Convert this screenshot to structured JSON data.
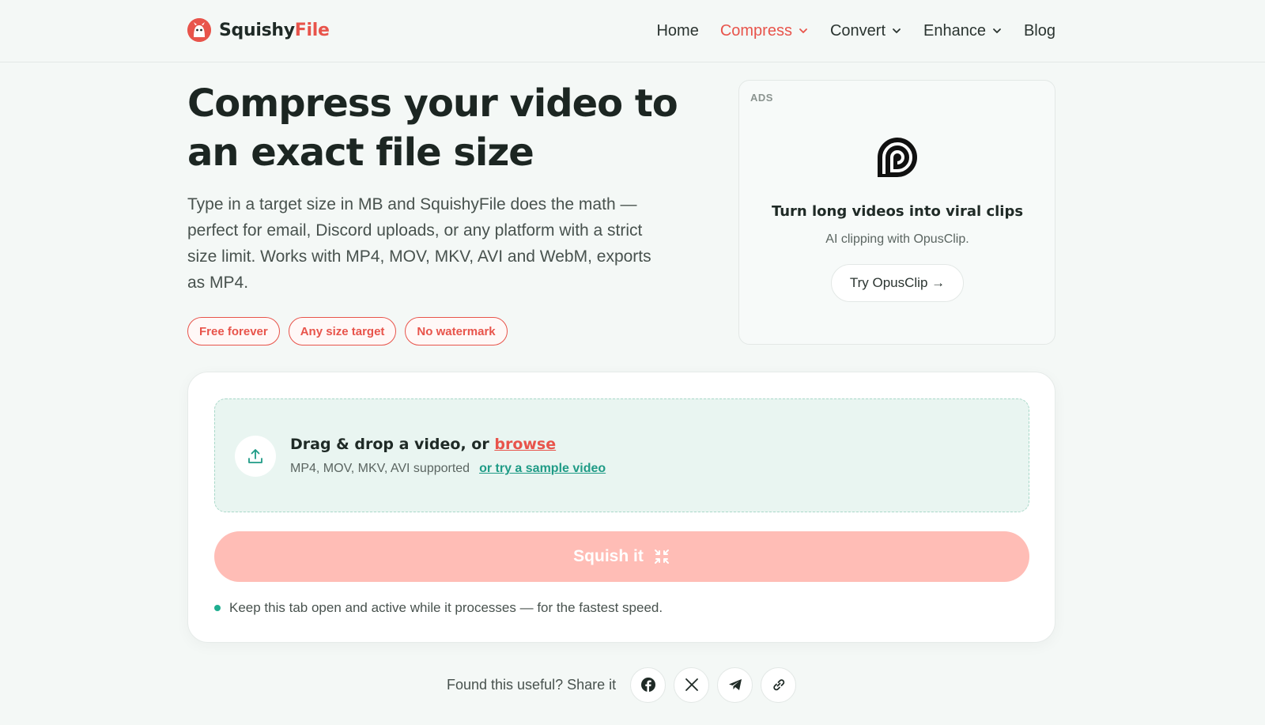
{
  "header": {
    "logo_part1": "Squishy",
    "logo_part2": "File",
    "nav": [
      {
        "label": "Home",
        "dropdown": false,
        "active": false
      },
      {
        "label": "Compress",
        "dropdown": true,
        "active": true
      },
      {
        "label": "Convert",
        "dropdown": true,
        "active": false
      },
      {
        "label": "Enhance",
        "dropdown": true,
        "active": false
      },
      {
        "label": "Blog",
        "dropdown": false,
        "active": false
      }
    ]
  },
  "hero": {
    "title": "Compress your video to an exact file size",
    "description": "Type in a target size in MB and SquishyFile does the math — perfect for email, Discord uploads, or any platform with a strict size limit. Works with MP4, MOV, MKV, AVI and WebM, exports as MP4.",
    "pills": [
      "Free forever",
      "Any size target",
      "No watermark"
    ]
  },
  "ad": {
    "label": "ADS",
    "title": "Turn long videos into viral clips",
    "subtitle": "AI clipping with OpusClip.",
    "button": "Try OpusClip →",
    "logo_icon": "opusclip-logo-icon"
  },
  "upload": {
    "title_prefix": "Drag & drop a video, or ",
    "browse": "browse",
    "formats": "MP4, MOV, MKV, AVI supported",
    "sample_link": "or try a sample video",
    "squish_button": "Squish it",
    "tip": "Keep this tab open and active while it processes — for the fastest speed."
  },
  "share": {
    "label": "Found this useful? Share it",
    "icons": [
      "facebook-icon",
      "x-icon",
      "telegram-icon",
      "link-icon"
    ]
  },
  "colors": {
    "accent": "#e8544b",
    "teal": "#1f9b86",
    "button_disabled": "#ffbdb6",
    "dropzone_bg": "#e9f5f1"
  }
}
